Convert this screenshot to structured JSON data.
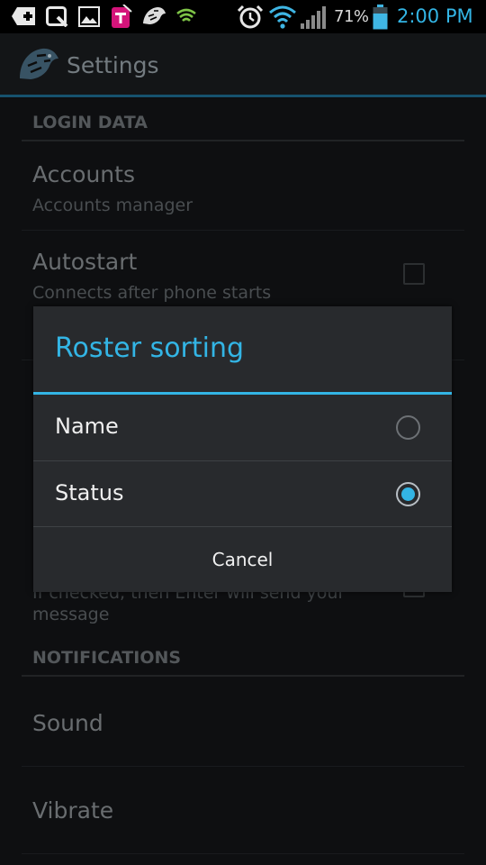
{
  "status_bar": {
    "icons_left": [
      "add-box-icon",
      "q-app-icon",
      "gallery-icon",
      "t-mobile-icon",
      "tiger-icon",
      "signal-app-icon"
    ],
    "icons_right": [
      "alarm-icon",
      "wifi-icon",
      "cell-signal-icon",
      "battery-icon"
    ],
    "battery_percent": "71%",
    "time": "2:00 PM"
  },
  "action_bar": {
    "title": "Settings",
    "logo_icon": "tiger-logo-icon"
  },
  "settings": {
    "login_header": "LOGIN DATA",
    "accounts_title": "Accounts",
    "accounts_summary": "Accounts manager",
    "autostart_title": "Autostart",
    "autostart_summary": "Connects after phone starts",
    "enter_summary_line1": "If checked, then Enter will send your",
    "enter_summary_line2": "message",
    "notifications_header": "NOTIFICATIONS",
    "sound_title": "Sound",
    "vibrate_title": "Vibrate"
  },
  "dialog": {
    "title": "Roster sorting",
    "options": [
      {
        "label": "Name",
        "selected": false
      },
      {
        "label": "Status",
        "selected": true
      }
    ],
    "cancel_label": "Cancel"
  },
  "colors": {
    "accent": "#33b5e5",
    "dialog_bg": "#282a2d",
    "page_bg": "#131517"
  }
}
